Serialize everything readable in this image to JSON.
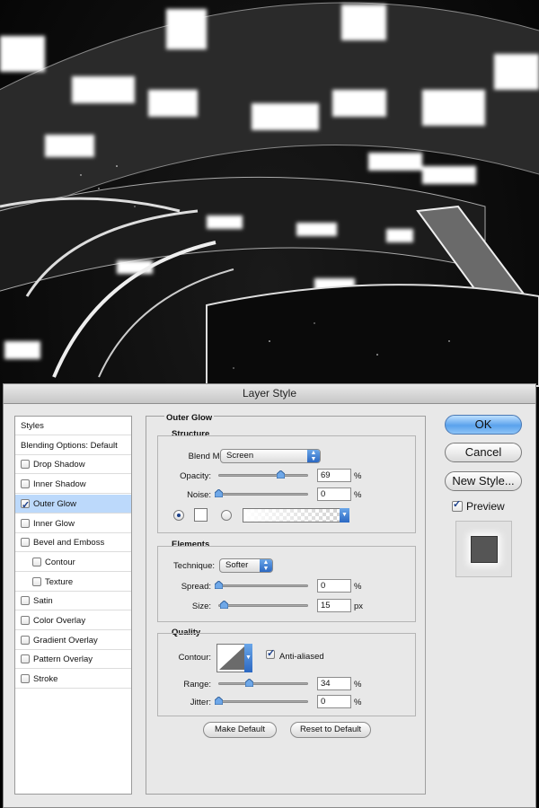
{
  "dialog": {
    "title": "Layer Style"
  },
  "styles_list": {
    "items": [
      {
        "label": "Styles",
        "checkbox": false,
        "checked": false,
        "selected": false,
        "indent": false
      },
      {
        "label": "Blending Options: Default",
        "checkbox": false,
        "checked": false,
        "selected": false,
        "indent": false
      },
      {
        "label": "Drop Shadow",
        "checkbox": true,
        "checked": false,
        "selected": false,
        "indent": false
      },
      {
        "label": "Inner Shadow",
        "checkbox": true,
        "checked": false,
        "selected": false,
        "indent": false
      },
      {
        "label": "Outer Glow",
        "checkbox": true,
        "checked": true,
        "selected": true,
        "indent": false
      },
      {
        "label": "Inner Glow",
        "checkbox": true,
        "checked": false,
        "selected": false,
        "indent": false
      },
      {
        "label": "Bevel and Emboss",
        "checkbox": true,
        "checked": false,
        "selected": false,
        "indent": false
      },
      {
        "label": "Contour",
        "checkbox": true,
        "checked": false,
        "selected": false,
        "indent": true
      },
      {
        "label": "Texture",
        "checkbox": true,
        "checked": false,
        "selected": false,
        "indent": true
      },
      {
        "label": "Satin",
        "checkbox": true,
        "checked": false,
        "selected": false,
        "indent": false
      },
      {
        "label": "Color Overlay",
        "checkbox": true,
        "checked": false,
        "selected": false,
        "indent": false
      },
      {
        "label": "Gradient Overlay",
        "checkbox": true,
        "checked": false,
        "selected": false,
        "indent": false
      },
      {
        "label": "Pattern Overlay",
        "checkbox": true,
        "checked": false,
        "selected": false,
        "indent": false
      },
      {
        "label": "Stroke",
        "checkbox": true,
        "checked": false,
        "selected": false,
        "indent": false
      }
    ]
  },
  "outer_glow": {
    "title": "Outer Glow",
    "structure": {
      "title": "Structure",
      "blend_mode_label": "Blend Mode:",
      "blend_mode": "Screen",
      "opacity_label": "Opacity:",
      "opacity": "69",
      "opacity_fraction": 0.69,
      "noise_label": "Noise:",
      "noise": "0",
      "noise_fraction": 0,
      "percent": "%",
      "color_mode": "solid"
    },
    "elements": {
      "title": "Elements",
      "technique_label": "Technique:",
      "technique": "Softer",
      "spread_label": "Spread:",
      "spread": "0",
      "spread_fraction": 0,
      "size_label": "Size:",
      "size": "15",
      "size_fraction": 0.06,
      "percent": "%",
      "px": "px"
    },
    "quality": {
      "title": "Quality",
      "contour_label": "Contour:",
      "anti_aliased_label": "Anti-aliased",
      "anti_aliased": true,
      "range_label": "Range:",
      "range": "34",
      "range_fraction": 0.34,
      "jitter_label": "Jitter:",
      "jitter": "0",
      "jitter_fraction": 0,
      "percent": "%"
    },
    "make_default_label": "Make Default",
    "reset_default_label": "Reset to Default"
  },
  "buttons": {
    "ok": "OK",
    "cancel": "Cancel",
    "new_style": "New Style...",
    "preview_label": "Preview",
    "preview_checked": true
  },
  "colors": {
    "accent": "#5aa2ec",
    "selected_row": "#bcd9fb",
    "preview_swatch": "#555555"
  }
}
